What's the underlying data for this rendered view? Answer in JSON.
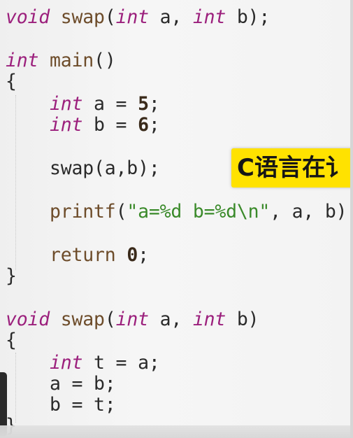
{
  "code": {
    "l1": {
      "kw": "void",
      "fn": "swap",
      "rest_a": "(",
      "kw2": "int",
      "rest_b": " a, ",
      "kw3": "int",
      "rest_c": " b);"
    },
    "l2": {
      "kw": "int",
      "fn": "main",
      "rest": "()"
    },
    "l3": {
      "text": "{"
    },
    "l4": {
      "indent": "    ",
      "kw": "int",
      "rest": " a = ",
      "num": "5",
      "end": ";"
    },
    "l5": {
      "indent": "    ",
      "kw": "int",
      "rest": " b = ",
      "num": "6",
      "end": ";"
    },
    "l6": {
      "indent": "    ",
      "text": "swap(a,b);"
    },
    "l7": {
      "indent": "    ",
      "fn": "printf",
      "open": "(",
      "str": "\"a=%d b=%d\\n\"",
      "rest": ", a, b);"
    },
    "l8": {
      "indent": "    ",
      "fn": "return",
      "sp": " ",
      "num": "0",
      "end": ";"
    },
    "l9": {
      "text": "}"
    },
    "l10": {
      "kw": "void",
      "fn": "swap",
      "rest_a": "(",
      "kw2": "int",
      "rest_b": " a, ",
      "kw3": "int",
      "rest_c": " b)"
    },
    "l11": {
      "text": "{"
    },
    "l12": {
      "indent": "    ",
      "kw": "int",
      "rest": " t = a;"
    },
    "l13": {
      "indent": "    ",
      "text": "a = b;"
    },
    "l14": {
      "indent": "    ",
      "text": "b = t;"
    },
    "l15": {
      "text": "}"
    }
  },
  "caption": {
    "text": "C语言在讠"
  },
  "colors": {
    "keyword": "#9b1f7c",
    "function": "#6d4c2a",
    "string": "#3a8a2a",
    "caption_bg": "#ffe200"
  }
}
